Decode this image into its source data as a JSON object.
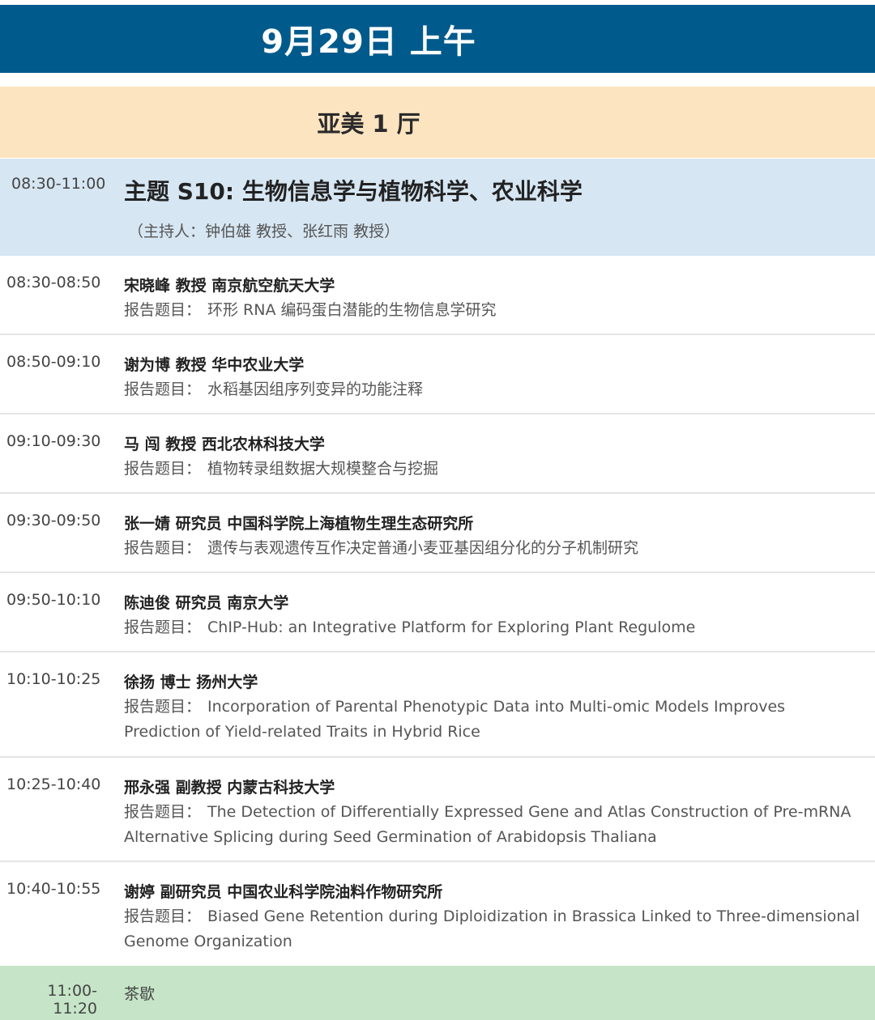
{
  "header": {
    "date_title": "9月29日 上午"
  },
  "hall": {
    "title": "亚美 1 厅"
  },
  "session": {
    "time": "08:30-11:00",
    "title": "主题 S10: 生物信息学与植物科学、农业科学",
    "host": "（主持人：钟伯雄 教授、张红雨 教授）"
  },
  "talk_prefix": "报告题目：",
  "talks": [
    {
      "time": "08:30-08:50",
      "speaker": "宋晓峰 教授 南京航空航天大学",
      "title": "环形 RNA 编码蛋白潜能的生物信息学研究"
    },
    {
      "time": "08:50-09:10",
      "speaker": "谢为博 教授 华中农业大学",
      "title": "水稻基因组序列变异的功能注释"
    },
    {
      "time": "09:10-09:30",
      "speaker": "马 闯 教授 西北农林科技大学",
      "title": "植物转录组数据大规模整合与挖掘"
    },
    {
      "time": "09:30-09:50",
      "speaker": "张一婧 研究员 中国科学院上海植物生理生态研究所",
      "title": "遗传与表观遗传互作决定普通小麦亚基因组分化的分子机制研究"
    },
    {
      "time": "09:50-10:10",
      "speaker": "陈迪俊 研究员 南京大学",
      "title": "ChIP-Hub: an Integrative Platform for Exploring Plant Regulome"
    },
    {
      "time": "10:10-10:25",
      "speaker": "徐扬 博士 扬州大学",
      "title": "Incorporation of Parental Phenotypic Data into Multi-omic Models Improves Prediction of Yield-related Traits in Hybrid Rice"
    },
    {
      "time": "10:25-10:40",
      "speaker": "邢永强 副教授 内蒙古科技大学",
      "title": "The Detection of Differentially Expressed Gene and Atlas Construction of Pre-mRNA Alternative Splicing during Seed Germination of Arabidopsis Thaliana"
    },
    {
      "time": "10:40-10:55",
      "speaker": "谢婷 副研究员 中国农业科学院油料作物研究所",
      "title": "Biased Gene Retention during Diploidization in Brassica Linked to Three-dimensional Genome Organization"
    }
  ],
  "break": {
    "time": "11:00-11:20",
    "label": "茶歇"
  }
}
